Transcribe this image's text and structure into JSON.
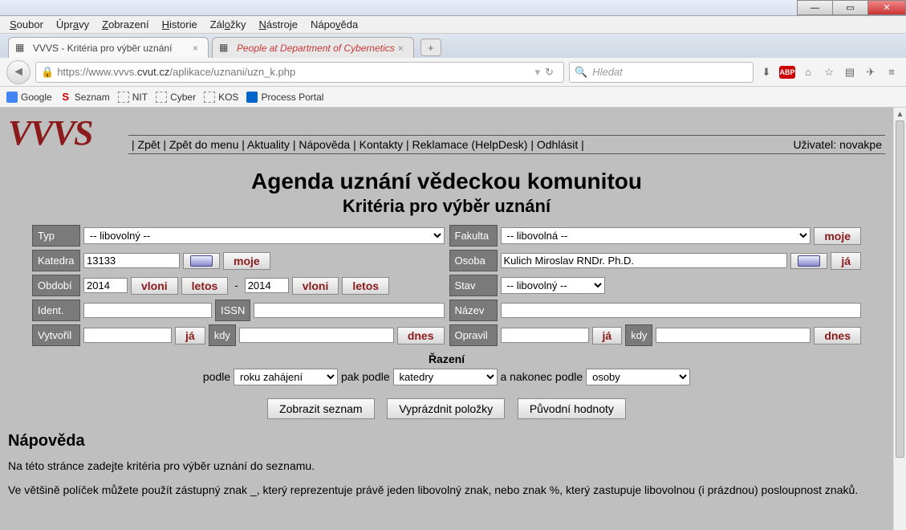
{
  "window": {
    "menus": [
      "Soubor",
      "Úpravy",
      "Zobrazení",
      "Historie",
      "Záložky",
      "Nástroje",
      "Nápověda"
    ]
  },
  "tabs": [
    {
      "title": "VVVS - Kritéria pro výběr uznání",
      "active": true
    },
    {
      "title": "People at Department of Cybernetics",
      "active": false
    }
  ],
  "url": {
    "prefix": "https://www.vvvs.",
    "domain": "cvut.cz",
    "path": "/aplikace/uznani/uzn_k.php"
  },
  "search": {
    "placeholder": "Hledat"
  },
  "toolbar_icons": [
    "download",
    "abp",
    "home",
    "star",
    "list",
    "send",
    "menu"
  ],
  "bookmarks": [
    {
      "icon": "g",
      "label": "Google"
    },
    {
      "icon": "s",
      "label": "Seznam"
    },
    {
      "icon": "d",
      "label": "NIT"
    },
    {
      "icon": "d",
      "label": "Cyber"
    },
    {
      "icon": "d",
      "label": "KOS"
    },
    {
      "icon": "p",
      "label": "Process Portal"
    }
  ],
  "page": {
    "logo": "VVVS",
    "nav": [
      "Zpět",
      "Zpět do menu",
      "Aktuality",
      "Nápověda",
      "Kontakty",
      "Reklamace (HelpDesk)",
      "Odhlásit"
    ],
    "user_label": "Uživatel:",
    "user_name": "novakpe",
    "heading1": "Agenda uznání vědeckou komunitou",
    "heading2": "Kritéria pro výběr uznání",
    "labels": {
      "typ": "Typ",
      "fakulta": "Fakulta",
      "katedra": "Katedra",
      "osoba": "Osoba",
      "obdobi": "Období",
      "stav": "Stav",
      "ident": "Ident.",
      "issn": "ISSN",
      "nazev": "Název",
      "vytvoril": "Vytvořil",
      "kdy1": "kdy",
      "opravil": "Opravil",
      "kdy2": "kdy"
    },
    "selects": {
      "typ": "-- libovolný --",
      "fakulta": "-- libovolná --",
      "stav": "-- libovolný --",
      "podle": "roku zahájení",
      "pakpodle": "katedry",
      "nakonec": "osoby"
    },
    "inputs": {
      "katedra": "13133",
      "osoba": "Kulich Miroslav RNDr. Ph.D.",
      "obdobi_from": "2014",
      "obdobi_to": "2014",
      "ident": "",
      "issn": "",
      "nazev": "",
      "vytvoril": "",
      "kdy1": "",
      "opravil": "",
      "kdy2": ""
    },
    "buttons": {
      "moje": "moje",
      "ja": "já",
      "vloni": "vloni",
      "letos": "letos",
      "dnes": "dnes",
      "zobrazit": "Zobrazit seznam",
      "vyprazdnit": "Vyprázdnit položky",
      "puvodni": "Původní hodnoty"
    },
    "sort": {
      "title": "Řazení",
      "lbl1": "podle",
      "lbl2": "pak podle",
      "lbl3": "a nakonec podle"
    },
    "help": {
      "title": "Nápověda",
      "p1": "Na této stránce zadejte kritéria pro výběr uznání do seznamu.",
      "p2": "Ve většině políček můžete použít zástupný znak _, který reprezentuje právě jeden libovolný znak, nebo znak %, který zastupuje libovolnou (i prázdnou) posloupnost znaků."
    }
  }
}
